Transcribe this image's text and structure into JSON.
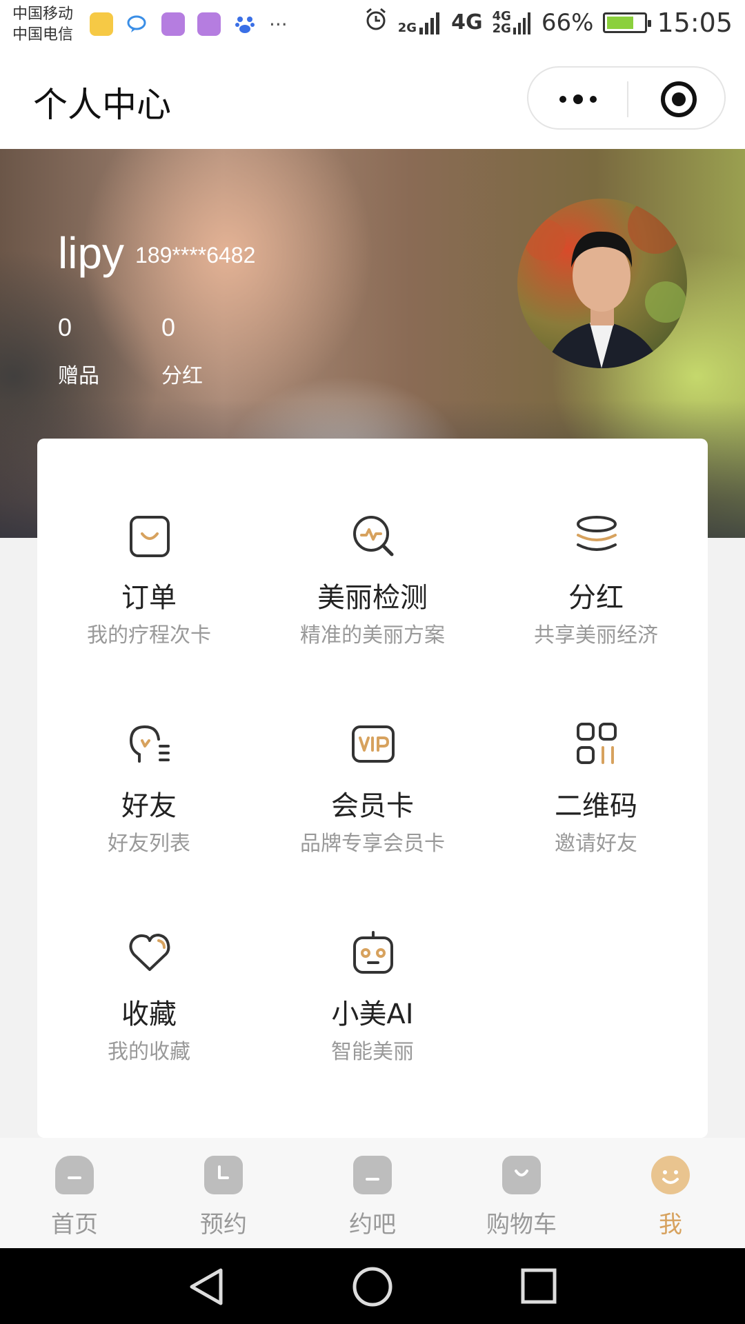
{
  "status_bar": {
    "carrier_1": "中国移动",
    "carrier_2": "中国电信",
    "more": "···",
    "net_2g": "2G",
    "net_4g": "4G",
    "net_4g_small": "4G",
    "net_2g_small": "2G",
    "battery": "66%",
    "time": "15:05"
  },
  "nav": {
    "title": "个人中心"
  },
  "profile": {
    "username": "lipy",
    "phone": "189****6482",
    "stats": [
      {
        "value": "0",
        "label": "赠品"
      },
      {
        "value": "0",
        "label": "分红"
      }
    ]
  },
  "menu": [
    {
      "title": "订单",
      "subtitle": "我的疗程次卡",
      "icon": "order-bag-icon"
    },
    {
      "title": "美丽检测",
      "subtitle": "精准的美丽方案",
      "icon": "beauty-scan-icon"
    },
    {
      "title": "分红",
      "subtitle": "共享美丽经济",
      "icon": "coins-stack-icon"
    },
    {
      "title": "好友",
      "subtitle": "好友列表",
      "icon": "friends-icon"
    },
    {
      "title": "会员卡",
      "subtitle": "品牌专享会员卡",
      "icon": "vip-card-icon"
    },
    {
      "title": "二维码",
      "subtitle": "邀请好友",
      "icon": "qr-code-icon"
    },
    {
      "title": "收藏",
      "subtitle": "我的收藏",
      "icon": "heart-icon"
    },
    {
      "title": "小美AI",
      "subtitle": "智能美丽",
      "icon": "robot-icon"
    }
  ],
  "tabs": [
    {
      "label": "首页",
      "icon": "home-icon",
      "active": false
    },
    {
      "label": "预约",
      "icon": "clock-icon",
      "active": false
    },
    {
      "label": "约吧",
      "icon": "chat-icon",
      "active": false
    },
    {
      "label": "购物车",
      "icon": "cart-bag-icon",
      "active": false
    },
    {
      "label": "我",
      "icon": "smile-icon",
      "active": true
    }
  ],
  "colors": {
    "accent": "#d7a25e",
    "icon_dark": "#333333",
    "subtitle": "#999999"
  }
}
